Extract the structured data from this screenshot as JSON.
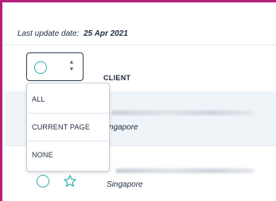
{
  "header": {
    "update_label": "Last update date:",
    "update_date": "25 Apr 2021"
  },
  "table": {
    "columns": [
      "CLIENT"
    ],
    "rows": [
      {
        "location": "Singapore",
        "name_visible": false
      },
      {
        "location": "Singapore",
        "name_visible": false
      }
    ]
  },
  "select_menu": {
    "options": [
      "ALL",
      "CURRENT PAGE",
      "NONE"
    ]
  },
  "colors": {
    "frame_accent": "#b41f7a",
    "radio_teal": "#2bb0aa",
    "row_highlight": "#eef4f8"
  },
  "icons": {
    "select_all": "radio-circle-icon",
    "sort": "sort-arrows-icon",
    "favorite": "star-icon"
  }
}
